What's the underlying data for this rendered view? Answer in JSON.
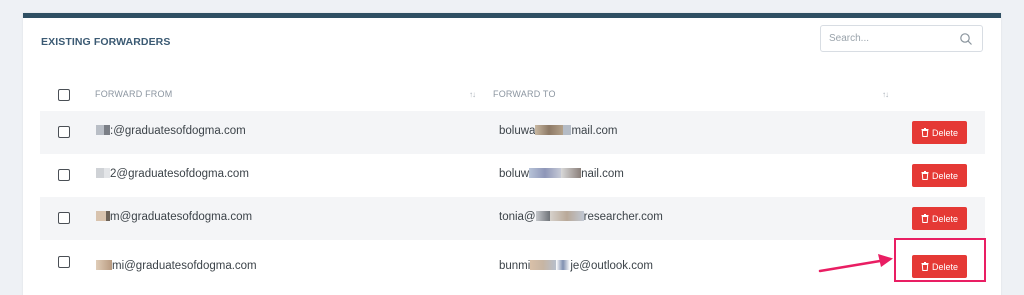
{
  "panel": {
    "title": "EXISTING FORWARDERS",
    "search_placeholder": "Search..."
  },
  "table": {
    "columns": [
      {
        "label": "FORWARD FROM",
        "sort": "↑↓"
      },
      {
        "label": "FORWARD TO",
        "sort": "↑↓"
      }
    ],
    "delete_label": "Delete",
    "rows": [
      {
        "from": ":@graduatesofdogma.com",
        "to_start": "boluwa",
        "to_end": "mail.com"
      },
      {
        "from": "2@graduatesofdogma.com",
        "to_start": "boluw",
        "to_end": "nail.com"
      },
      {
        "from": "m@graduatesofdogma.com",
        "to_start": "tonia@",
        "to_end": "researcher.com"
      },
      {
        "from": "mi@graduatesofdogma.com",
        "to_start": "bunmi",
        "to_end": "je@outlook.com"
      }
    ]
  },
  "annotation": {
    "color": "#e91e63",
    "target": "Delete"
  }
}
